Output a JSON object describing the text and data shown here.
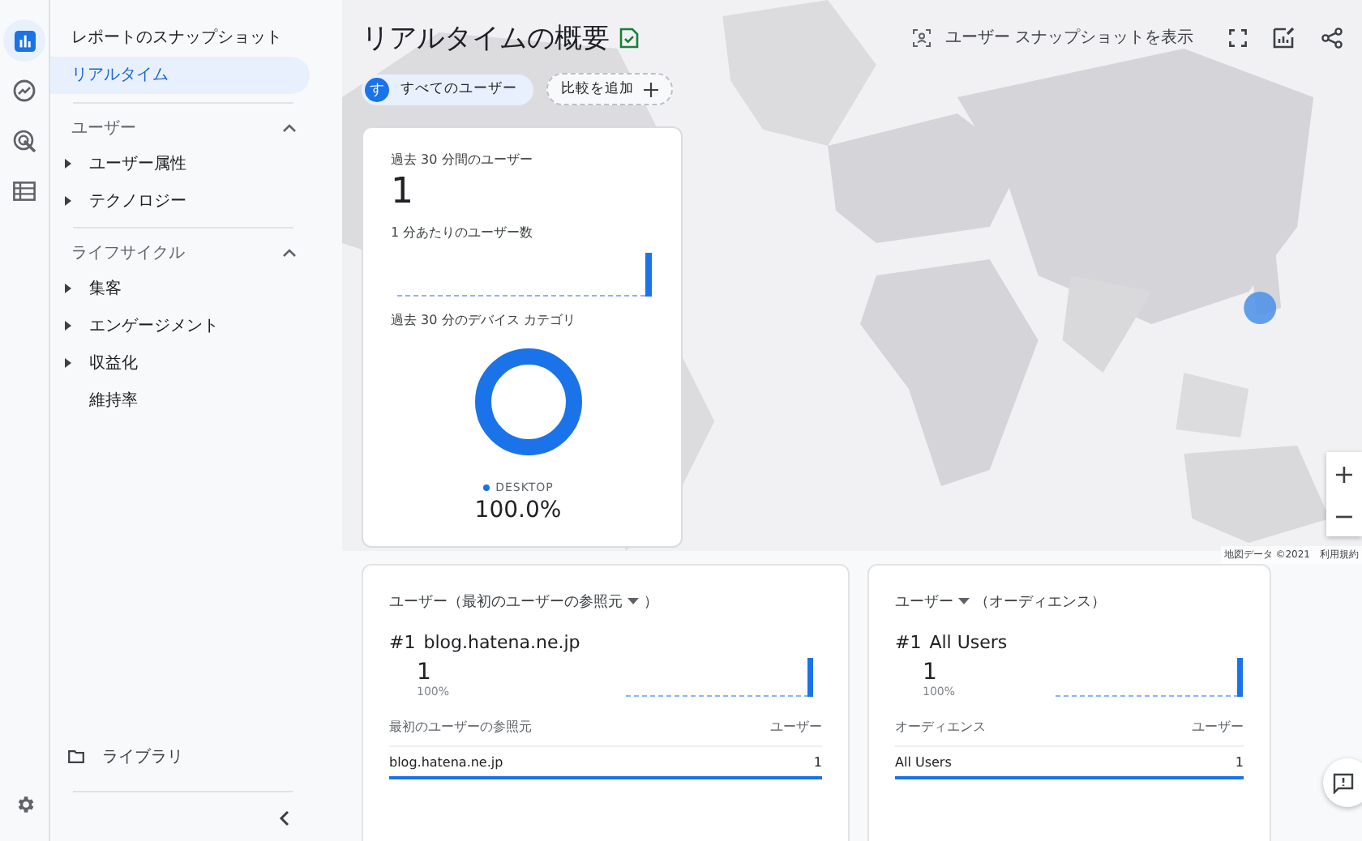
{
  "rail": {
    "items": [
      {
        "kind": "reports",
        "selected": true
      },
      {
        "kind": "explore",
        "selected": false
      },
      {
        "kind": "advertising",
        "selected": false
      },
      {
        "kind": "configure",
        "selected": false
      }
    ]
  },
  "nav": {
    "top_items": [
      {
        "label": "レポートのスナップショット",
        "selected": false
      },
      {
        "label": "リアルタイム",
        "selected": true
      }
    ],
    "sections": [
      {
        "title": "ユーザー",
        "expanded": true,
        "items": [
          {
            "label": "ユーザー属性",
            "expandable": true
          },
          {
            "label": "テクノロジー",
            "expandable": true
          }
        ]
      },
      {
        "title": "ライフサイクル",
        "expanded": true,
        "items": [
          {
            "label": "集客",
            "expandable": true
          },
          {
            "label": "エンゲージメント",
            "expandable": true
          },
          {
            "label": "収益化",
            "expandable": true
          },
          {
            "label": "維持率",
            "expandable": false
          }
        ]
      }
    ],
    "library": "ライブラリ"
  },
  "header": {
    "title": "リアルタイムの概要",
    "snapshot_button": "ユーザー スナップショットを表示"
  },
  "comparisons": {
    "chips": [
      {
        "avatar": "す",
        "label": "すべてのユーザー"
      }
    ],
    "add_button": "比較を追加"
  },
  "overview": {
    "users_label": "過去 30 分間のユーザー",
    "users_value": "1",
    "per_minute_label": "1 分あたりのユーザー数",
    "device_label": "過去 30 分のデバイス カテゴリ",
    "legend": [
      {
        "label": "DESKTOP",
        "value": "100.0%",
        "color": "#1a73e8"
      }
    ]
  },
  "cards": [
    {
      "title_before": "ユーザー（最初のユーザーの参照元",
      "title_after": "）",
      "rank": "#1",
      "top_name": "blog.hatena.ne.jp",
      "top_value": "1",
      "top_share": "100%",
      "columns": [
        "最初のユーザーの参照元",
        "ユーザー"
      ],
      "rows": [
        {
          "name": "blog.hatena.ne.jp",
          "value": "1"
        }
      ]
    },
    {
      "title_before": "ユーザー",
      "title_after": "（オーディエンス）",
      "rank": "#1",
      "top_name": "All Users",
      "top_value": "1",
      "top_share": "100%",
      "columns": [
        "オーディエンス",
        "ユーザー"
      ],
      "rows": [
        {
          "name": "All Users",
          "value": "1"
        }
      ]
    }
  ],
  "map": {
    "zoom_in": "+",
    "zoom_out": "−",
    "attribution": "地図データ ©2021",
    "terms": "利用規約"
  }
}
